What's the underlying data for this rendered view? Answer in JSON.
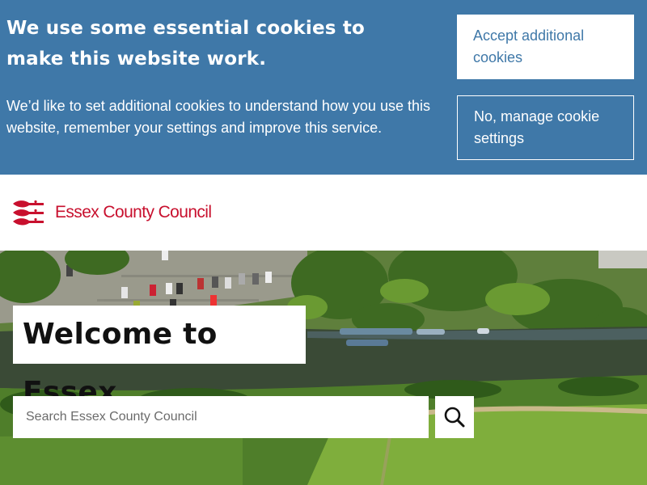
{
  "cookie_banner": {
    "heading": "We use some essential cookies to make this website work.",
    "body": "We’d like to set additional cookies to understand how you use this website, remember your settings and improve this service.",
    "accept_label": "Accept additional cookies",
    "manage_label": "No, manage cookie settings",
    "background_color": "#3f78a8"
  },
  "header": {
    "logo_text": "Essex County Council",
    "logo_icon": "three-seaxes-icon",
    "brand_color": "#c8102e"
  },
  "hero": {
    "title": "Welcome to Essex",
    "background": "aerial-river-landscape"
  },
  "search": {
    "placeholder": "Search Essex County Council",
    "value": "",
    "button_icon": "search-icon"
  }
}
